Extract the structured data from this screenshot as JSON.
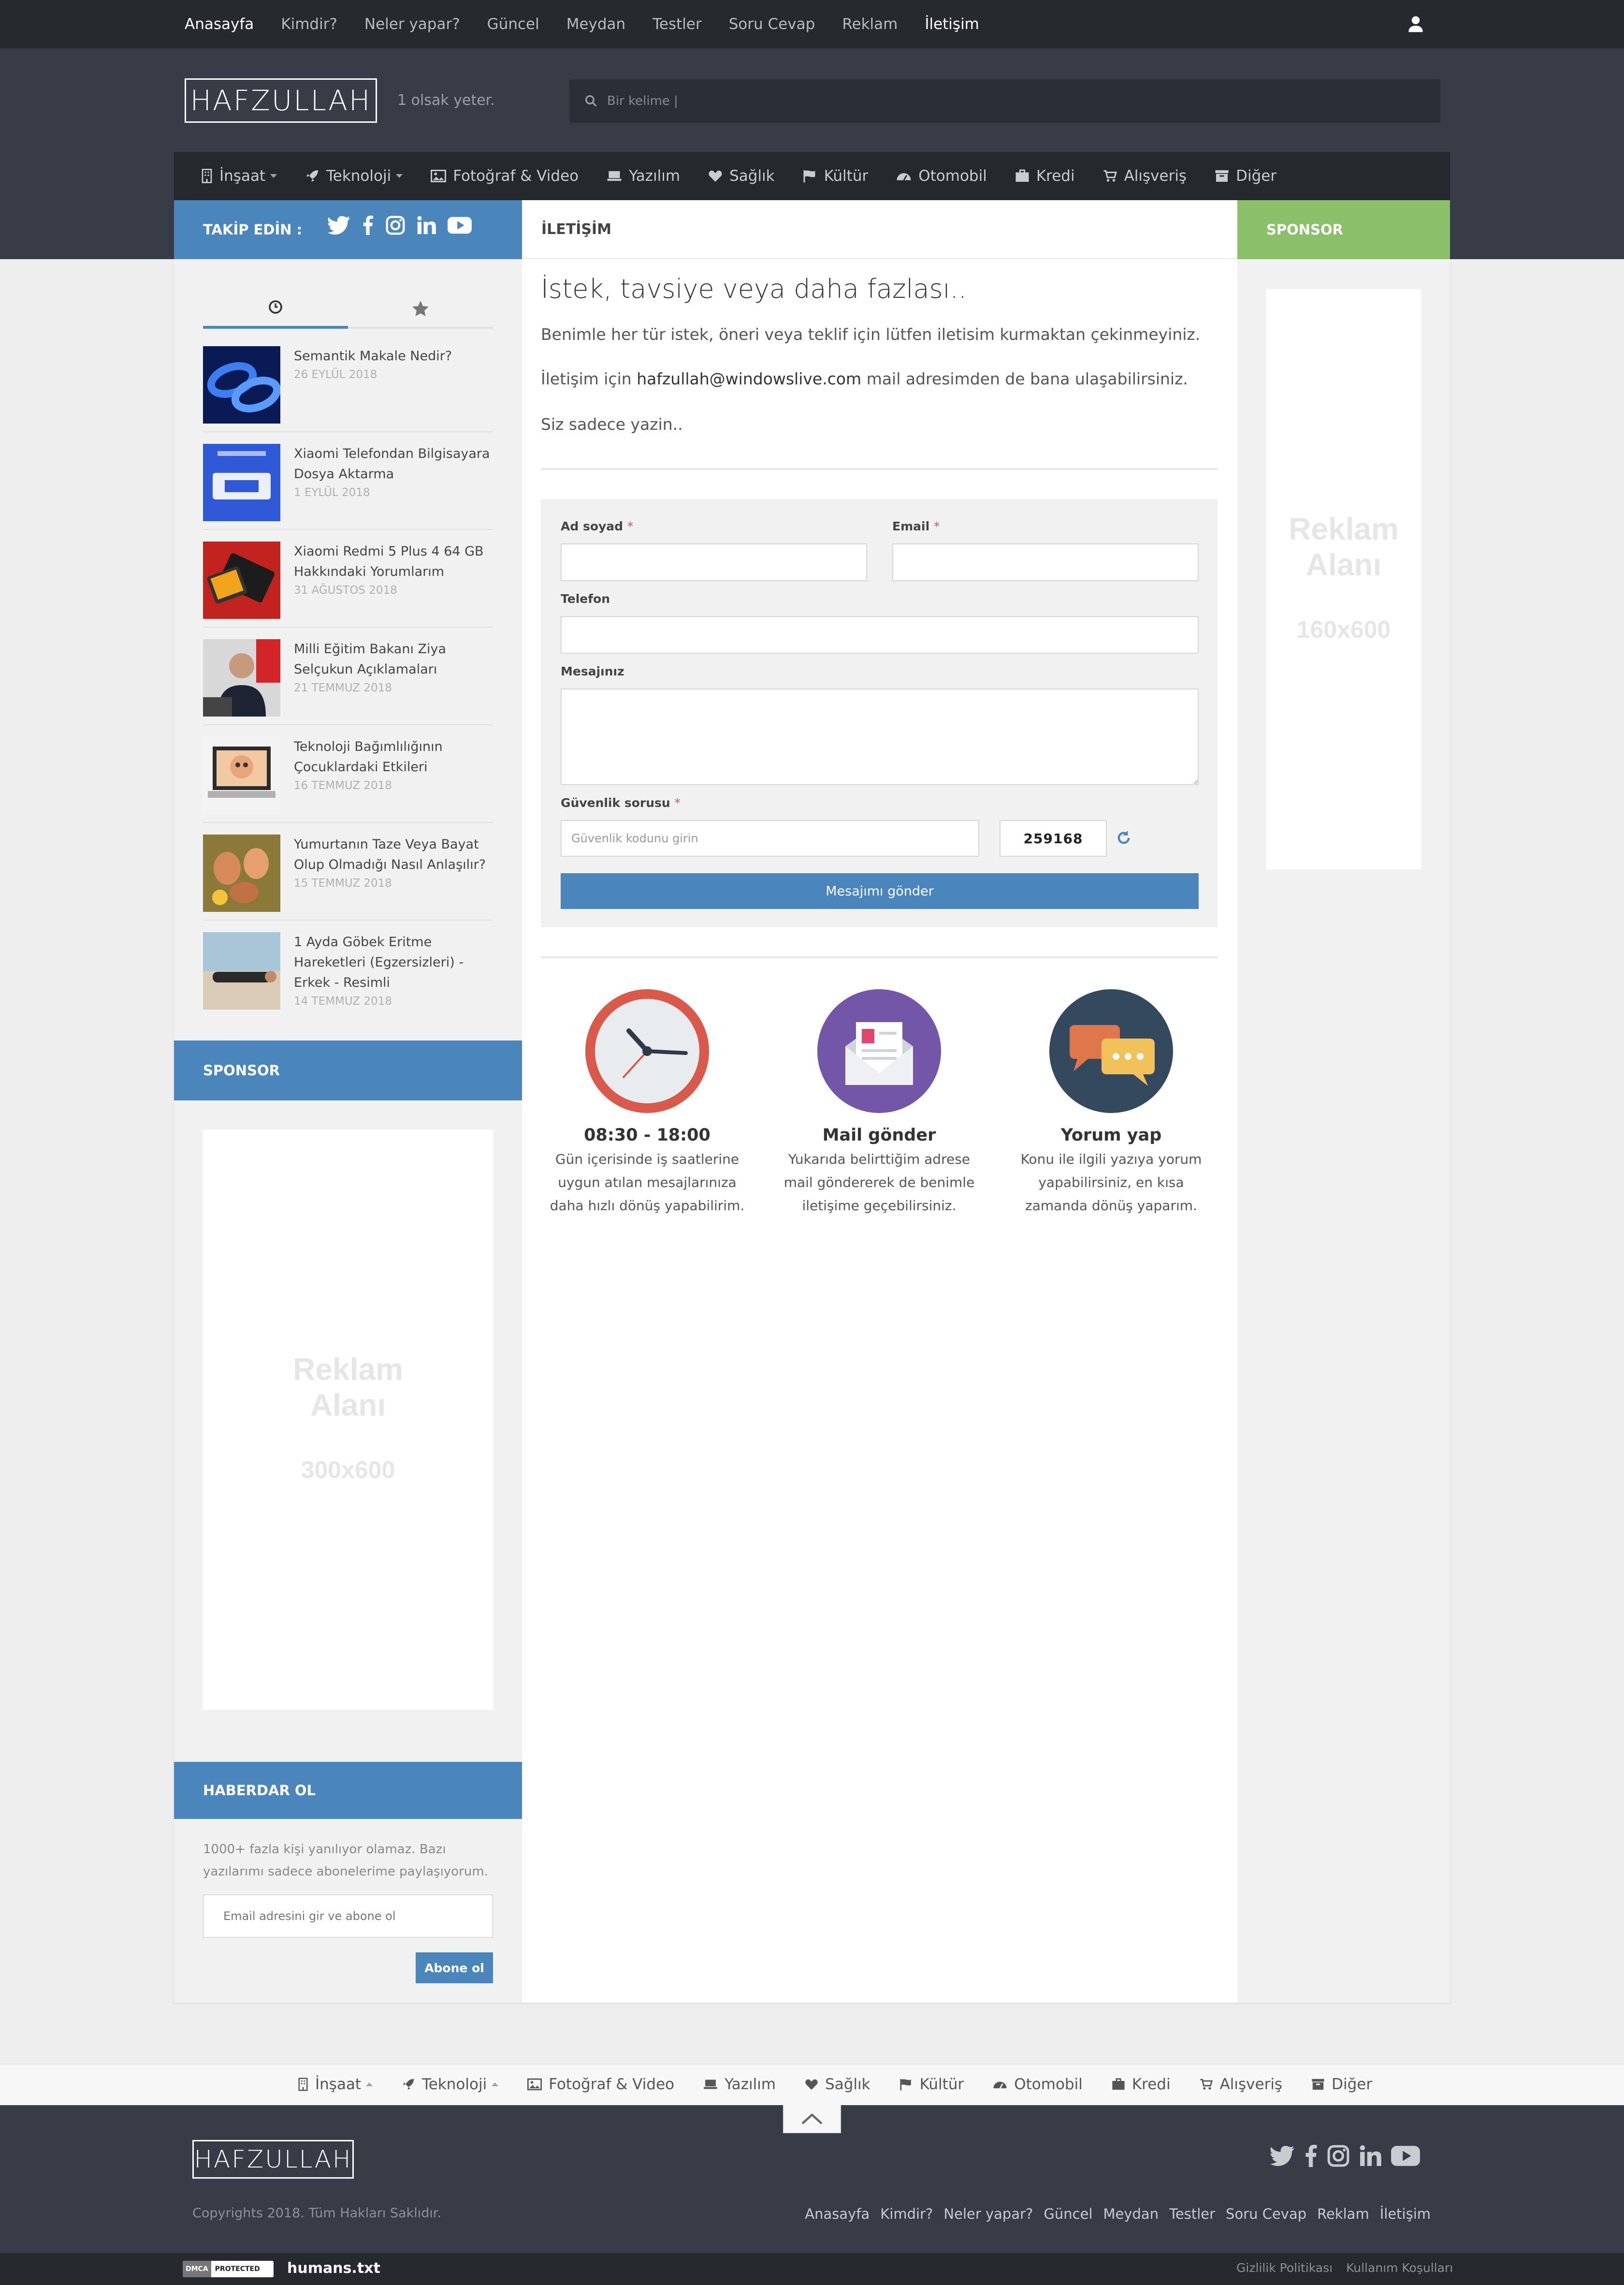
{
  "topnav": [
    "Anasayfa",
    "Kimdir?",
    "Neler yapar?",
    "Güncel",
    "Meydan",
    "Testler",
    "Soru Cevap",
    "Reklam",
    "İletişim"
  ],
  "brand": {
    "logo": "HAFZULLAH",
    "slogan": "1 olsak yeter."
  },
  "search": {
    "placeholder": "Bir kelime |"
  },
  "categories": [
    {
      "label": "İnşaat",
      "icon": "building-icon",
      "dropdown": true
    },
    {
      "label": "Teknoloji",
      "icon": "rocket-icon",
      "dropdown": true
    },
    {
      "label": "Fotoğraf & Video",
      "icon": "image-icon",
      "dropdown": false
    },
    {
      "label": "Yazılım",
      "icon": "keyboard-icon",
      "dropdown": false
    },
    {
      "label": "Sağlık",
      "icon": "heart-icon",
      "dropdown": false
    },
    {
      "label": "Kültür",
      "icon": "flag-icon",
      "dropdown": false
    },
    {
      "label": "Otomobil",
      "icon": "dashboard-icon",
      "dropdown": false
    },
    {
      "label": "Kredi",
      "icon": "briefcase-icon",
      "dropdown": false
    },
    {
      "label": "Alışveriş",
      "icon": "cart-icon",
      "dropdown": false
    },
    {
      "label": "Diğer",
      "icon": "archive-icon",
      "dropdown": false
    }
  ],
  "sidebar": {
    "follow_title": "TAKİP EDİN :",
    "posts": [
      {
        "title": "Semantik Makale Nedir?",
        "date": "26 EYLÜL 2018"
      },
      {
        "title": "Xiaomi Telefondan Bilgisayara Dosya Aktarma",
        "date": "1 EYLÜL 2018"
      },
      {
        "title": "Xiaomi Redmi 5 Plus 4 64 GB Hakkındaki Yorumlarım",
        "date": "31 AĞUSTOS 2018"
      },
      {
        "title": "Milli Eğitim Bakanı Ziya Selçukun Açıklamaları",
        "date": "21 TEMMUZ 2018"
      },
      {
        "title": "Teknoloji Bağımlılığının Çocuklardaki Etkileri",
        "date": "16 TEMMUZ 2018"
      },
      {
        "title": "Yumurtanın Taze Veya Bayat Olup Olmadığı Nasıl Anlaşılır?",
        "date": "15 TEMMUZ 2018"
      },
      {
        "title": "1 Ayda Göbek Eritme Hareketleri (Egzersizleri) - Erkek - Resimli",
        "date": "14 TEMMUZ 2018"
      }
    ],
    "sponsor_title": "SPONSOR",
    "ad_left": {
      "line1": "Reklam",
      "line2": "Alanı",
      "size": "300x600"
    },
    "haberdar_title": "HABERDAR OL",
    "haberdar_text": "1000+ fazla kişi yanılıyor olamaz. Bazı yazılarımı sadece abonelerime paylaşıyorum.",
    "subscribe_placeholder": "Email adresini gir ve abone ol",
    "subscribe_button": "Abone ol"
  },
  "main": {
    "section_title": "İLETİŞİM",
    "title": "İstek, tavsiye veya daha fazlası..",
    "p1": "Benimle her tür istek, öneri veya teklif için lütfen iletisim kurmaktan çekinmeyiniz.",
    "p2_pre": "İletişim için ",
    "email": "hafzullah@windowslive.com",
    "p2_post": " mail adresimden de bana ulaşabilirsiniz.",
    "p3": "Siz sadece yazin..",
    "form": {
      "name_label": "Ad soyad",
      "email_label": "Email",
      "phone_label": "Telefon",
      "message_label": "Mesajınız",
      "security_label": "Güvenlik sorusu",
      "security_placeholder": "Güvenlik kodunu girin",
      "captcha": "259168",
      "submit": "Mesajımı gönder",
      "required_mark": "*"
    },
    "features": [
      {
        "title": "08:30 - 18:00",
        "desc": "Gün içerisinde iş saatlerine uygun atılan mesajlarınıza daha hızlı dönüş yapabilirim.",
        "icon": "clock-icon"
      },
      {
        "title": "Mail gönder",
        "desc": "Yukarıda belirttiğim adrese mail göndererek de benimle iletişime geçebilirsiniz.",
        "icon": "mail-icon"
      },
      {
        "title": "Yorum yap",
        "desc": "Konu ile ilgili yazıya yorum yapabilirsiniz, en kısa zamanda dönüş yaparım.",
        "icon": "chat-icon"
      }
    ]
  },
  "right": {
    "sponsor_title": "SPONSOR",
    "ad": {
      "line1": "Reklam",
      "line2": "Alanı",
      "size": "160x600"
    }
  },
  "footer": {
    "logo": "HAFZULLAH",
    "copyright": "Copyrights 2018. Tüm Hakları Saklıdır.",
    "links": [
      "Anasayfa",
      "Kimdir?",
      "Neler yapar?",
      "Güncel",
      "Meydan",
      "Testler",
      "Soru Cevap",
      "Reklam",
      "İletişim"
    ],
    "dmca_left": "DMCA",
    "dmca_right": "PROTECTED",
    "humans": "humans.txt",
    "bottom_links": [
      "Gizlilik Politikası",
      "Kullanım Koşulları"
    ]
  },
  "colors": {
    "accent": "#4a86bc",
    "sponsor_green": "#8bbf6a",
    "dark": "#383c47",
    "darker": "#26292e"
  }
}
